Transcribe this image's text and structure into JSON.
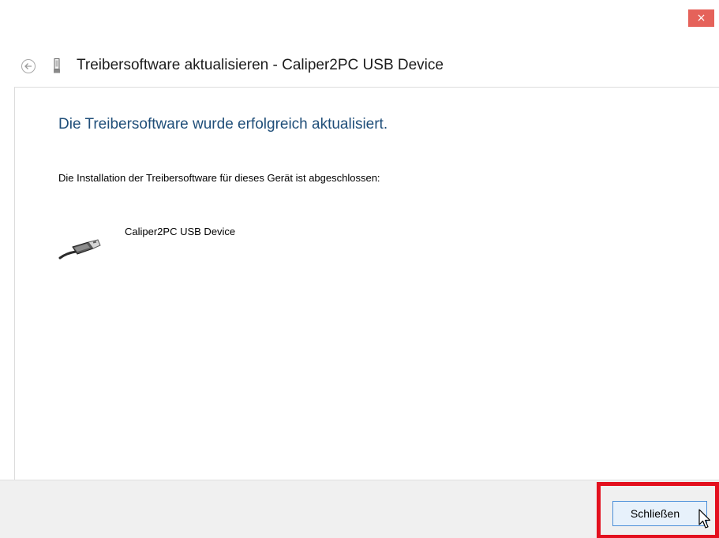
{
  "titlebar": {
    "close_glyph": "×"
  },
  "header": {
    "back_icon": "back-arrow-icon",
    "device_icon": "usb-plug-icon",
    "title": "Treibersoftware aktualisieren - Caliper2PC USB Device"
  },
  "content": {
    "heading": "Die Treibersoftware wurde erfolgreich aktualisiert.",
    "install_text": "Die Installation der Treibersoftware für dieses Gerät ist abgeschlossen:",
    "device_icon": "usb-cable-icon",
    "device_name": "Caliper2PC USB Device"
  },
  "footer": {
    "close_label": "Schließen"
  },
  "colors": {
    "close_button_bg": "#e5625a",
    "heading_text": "#1f4e79",
    "highlight": "#e3101e",
    "button_border": "#4b8fd8",
    "footer_bg": "#f0f0f0"
  }
}
